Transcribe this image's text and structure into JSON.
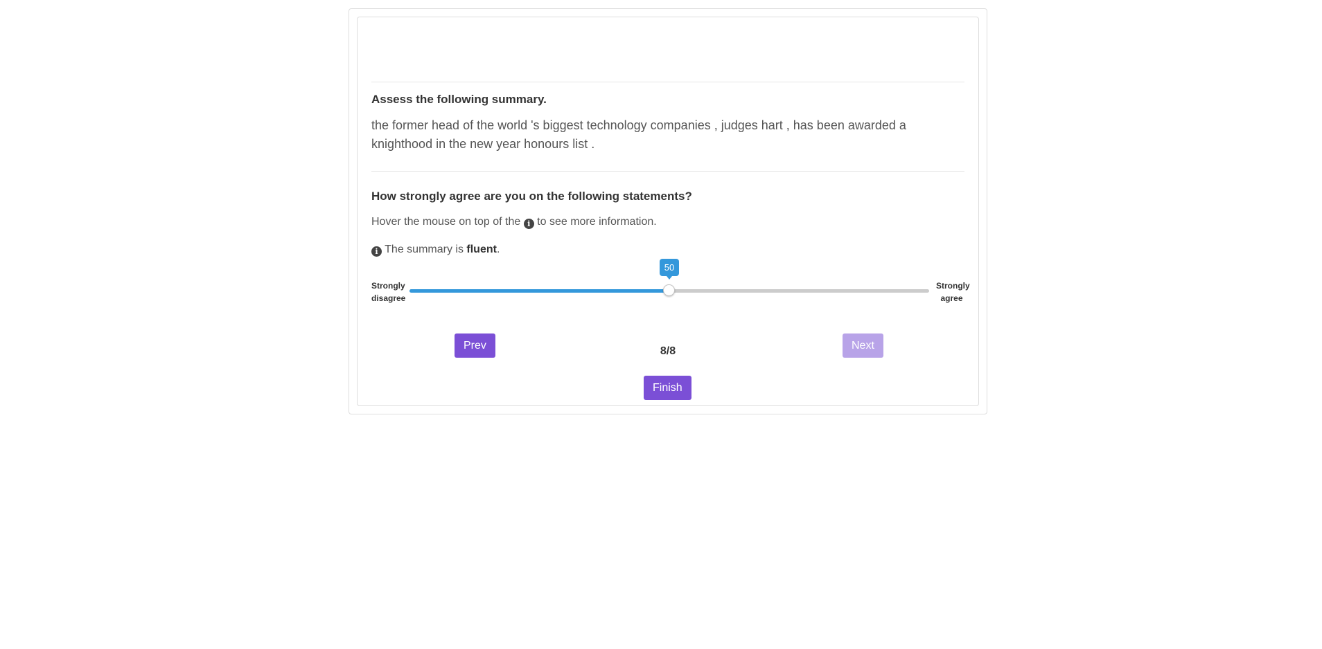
{
  "summary_section": {
    "heading": "Assess the following summary.",
    "text": "the former head of the world 's biggest technology companies , judges hart , has been awarded a knighthood in the new year honours list ."
  },
  "question_section": {
    "heading": "How strongly agree are you on the following statements?",
    "hover_hint_before": "Hover the mouse on top of the",
    "hover_hint_after": "to see more information.",
    "info_icon": "info-circle-icon"
  },
  "statement": {
    "prefix": "The summary is",
    "keyword": "fluent",
    "suffix": "."
  },
  "slider": {
    "min_label_line1": "Strongly",
    "min_label_line2": "disagree",
    "max_label_line1": "Strongly",
    "max_label_line2": "agree",
    "value": 50,
    "value_text": "50",
    "min": 0,
    "max": 100,
    "fill_color": "#3498db",
    "track_color": "#cccccc"
  },
  "navigation": {
    "prev_label": "Prev",
    "next_label": "Next",
    "next_disabled": true,
    "page_indicator": "8/8",
    "finish_label": "Finish",
    "button_color": "#7b4fd6",
    "disabled_button_color": "#b8a3e8"
  }
}
